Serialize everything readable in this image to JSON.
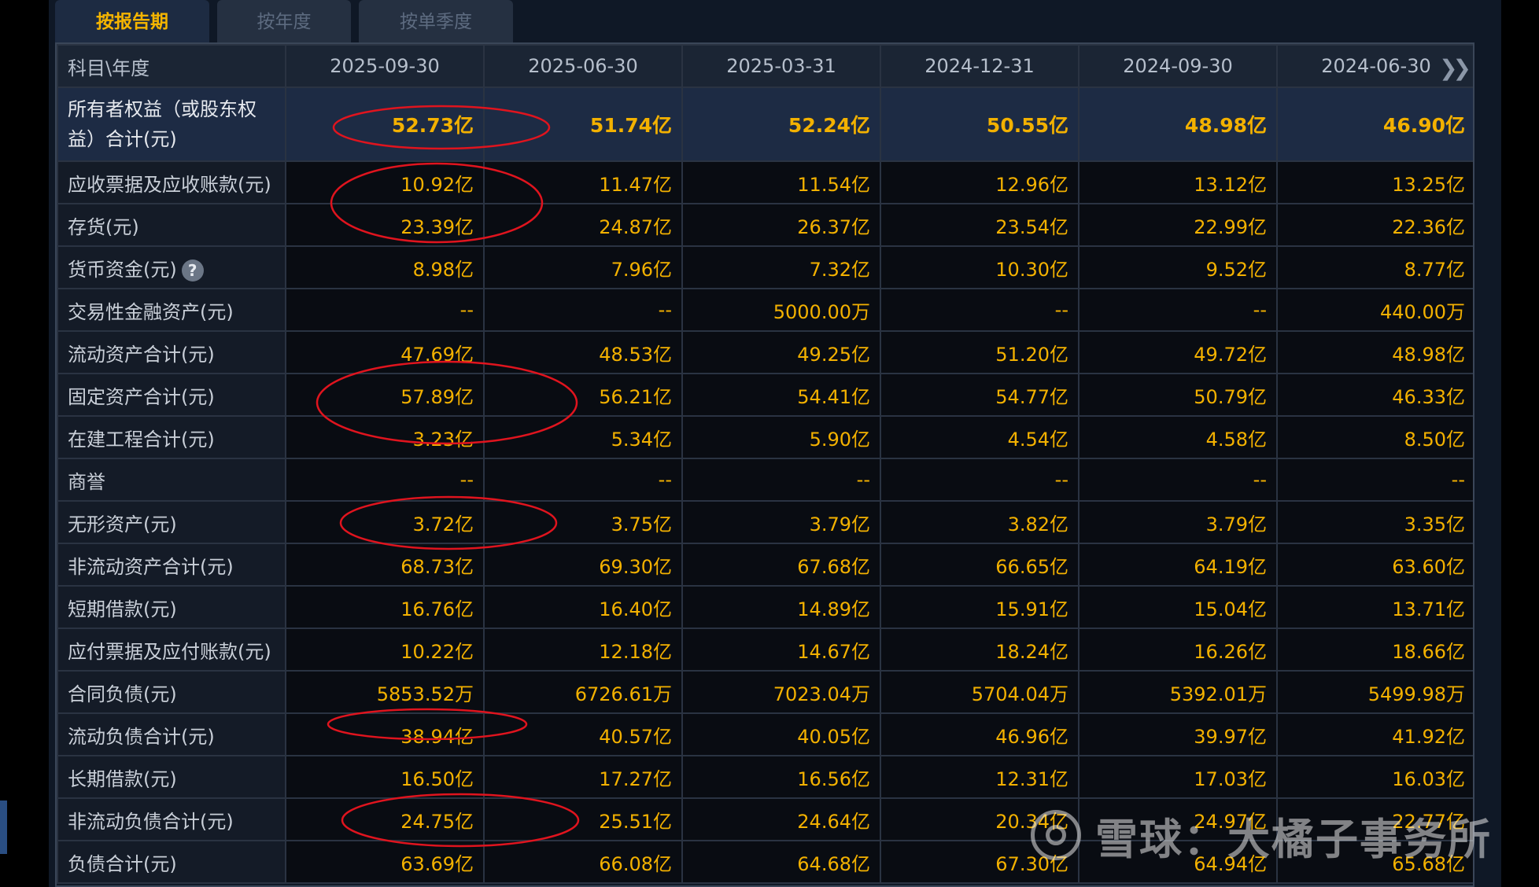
{
  "tabs": [
    {
      "label": "按报告期",
      "active": true
    },
    {
      "label": "按年度",
      "active": false
    },
    {
      "label": "按单季度",
      "active": false
    }
  ],
  "table": {
    "header_label": "科目\\年度",
    "dates": [
      "2025-09-30",
      "2025-06-30",
      "2025-03-31",
      "2024-12-31",
      "2024-09-30",
      "2024-06-30"
    ],
    "rows": [
      {
        "label": "所有者权益（或股东权益）合计(元)",
        "values": [
          "52.73亿",
          "51.74亿",
          "52.24亿",
          "50.55亿",
          "48.98亿",
          "46.90亿"
        ],
        "highlight": true
      },
      {
        "label": "应收票据及应收账款(元)",
        "values": [
          "10.92亿",
          "11.47亿",
          "11.54亿",
          "12.96亿",
          "13.12亿",
          "13.25亿"
        ]
      },
      {
        "label": "存货(元)",
        "values": [
          "23.39亿",
          "24.87亿",
          "26.37亿",
          "23.54亿",
          "22.99亿",
          "22.36亿"
        ]
      },
      {
        "label": "货币资金(元)",
        "values": [
          "8.98亿",
          "7.96亿",
          "7.32亿",
          "10.30亿",
          "9.52亿",
          "8.77亿"
        ],
        "help": true
      },
      {
        "label": "交易性金融资产(元)",
        "values": [
          "--",
          "--",
          "5000.00万",
          "--",
          "--",
          "440.00万"
        ]
      },
      {
        "label": "流动资产合计(元)",
        "values": [
          "47.69亿",
          "48.53亿",
          "49.25亿",
          "51.20亿",
          "49.72亿",
          "48.98亿"
        ]
      },
      {
        "label": "固定资产合计(元)",
        "values": [
          "57.89亿",
          "56.21亿",
          "54.41亿",
          "54.77亿",
          "50.79亿",
          "46.33亿"
        ]
      },
      {
        "label": "在建工程合计(元)",
        "values": [
          "3.23亿",
          "5.34亿",
          "5.90亿",
          "4.54亿",
          "4.58亿",
          "8.50亿"
        ]
      },
      {
        "label": "商誉",
        "values": [
          "--",
          "--",
          "--",
          "--",
          "--",
          "--"
        ]
      },
      {
        "label": "无形资产(元)",
        "values": [
          "3.72亿",
          "3.75亿",
          "3.79亿",
          "3.82亿",
          "3.79亿",
          "3.35亿"
        ]
      },
      {
        "label": "非流动资产合计(元)",
        "values": [
          "68.73亿",
          "69.30亿",
          "67.68亿",
          "66.65亿",
          "64.19亿",
          "63.60亿"
        ]
      },
      {
        "label": "短期借款(元)",
        "values": [
          "16.76亿",
          "16.40亿",
          "14.89亿",
          "15.91亿",
          "15.04亿",
          "13.71亿"
        ]
      },
      {
        "label": "应付票据及应付账款(元)",
        "values": [
          "10.22亿",
          "12.18亿",
          "14.67亿",
          "18.24亿",
          "16.26亿",
          "18.66亿"
        ]
      },
      {
        "label": "合同负债(元)",
        "values": [
          "5853.52万",
          "6726.61万",
          "7023.04万",
          "5704.04万",
          "5392.01万",
          "5499.98万"
        ]
      },
      {
        "label": "流动负债合计(元)",
        "values": [
          "38.94亿",
          "40.57亿",
          "40.05亿",
          "46.96亿",
          "39.97亿",
          "41.92亿"
        ]
      },
      {
        "label": "长期借款(元)",
        "values": [
          "16.50亿",
          "17.27亿",
          "16.56亿",
          "12.31亿",
          "17.03亿",
          "16.03亿"
        ]
      },
      {
        "label": "非流动负债合计(元)",
        "values": [
          "24.75亿",
          "25.51亿",
          "24.64亿",
          "20.34亿",
          "24.97亿",
          "22.77亿"
        ]
      },
      {
        "label": "负债合计(元)",
        "values": [
          "63.69亿",
          "66.08亿",
          "64.68亿",
          "67.30亿",
          "64.94亿",
          "65.68亿"
        ]
      }
    ]
  },
  "watermark": {
    "text": "雪球：大橘子事务所"
  },
  "colors": {
    "value": "#f3b100",
    "annotation": "#e0141e",
    "active_tab": "#f4b400"
  }
}
